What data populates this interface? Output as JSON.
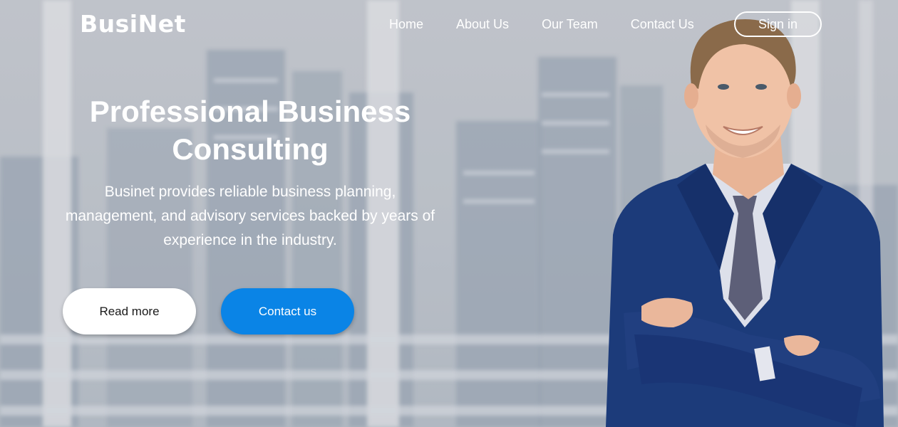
{
  "brand": {
    "logo_text": "BusiNet"
  },
  "nav": {
    "items": [
      {
        "label": "Home"
      },
      {
        "label": "About Us"
      },
      {
        "label": "Our Team"
      },
      {
        "label": "Contact Us"
      }
    ],
    "signin_label": "Sign in"
  },
  "hero": {
    "title_line1": "Professional Business",
    "title_line2": "Consulting",
    "description": "Businet provides reliable business planning, management, and advisory services backed by years of experience in the industry.",
    "read_more_label": "Read more",
    "contact_label": "Contact us"
  },
  "colors": {
    "accent": "#0a84e6",
    "suit": "#1c3b7a",
    "text_on_dark": "#ffffff"
  }
}
